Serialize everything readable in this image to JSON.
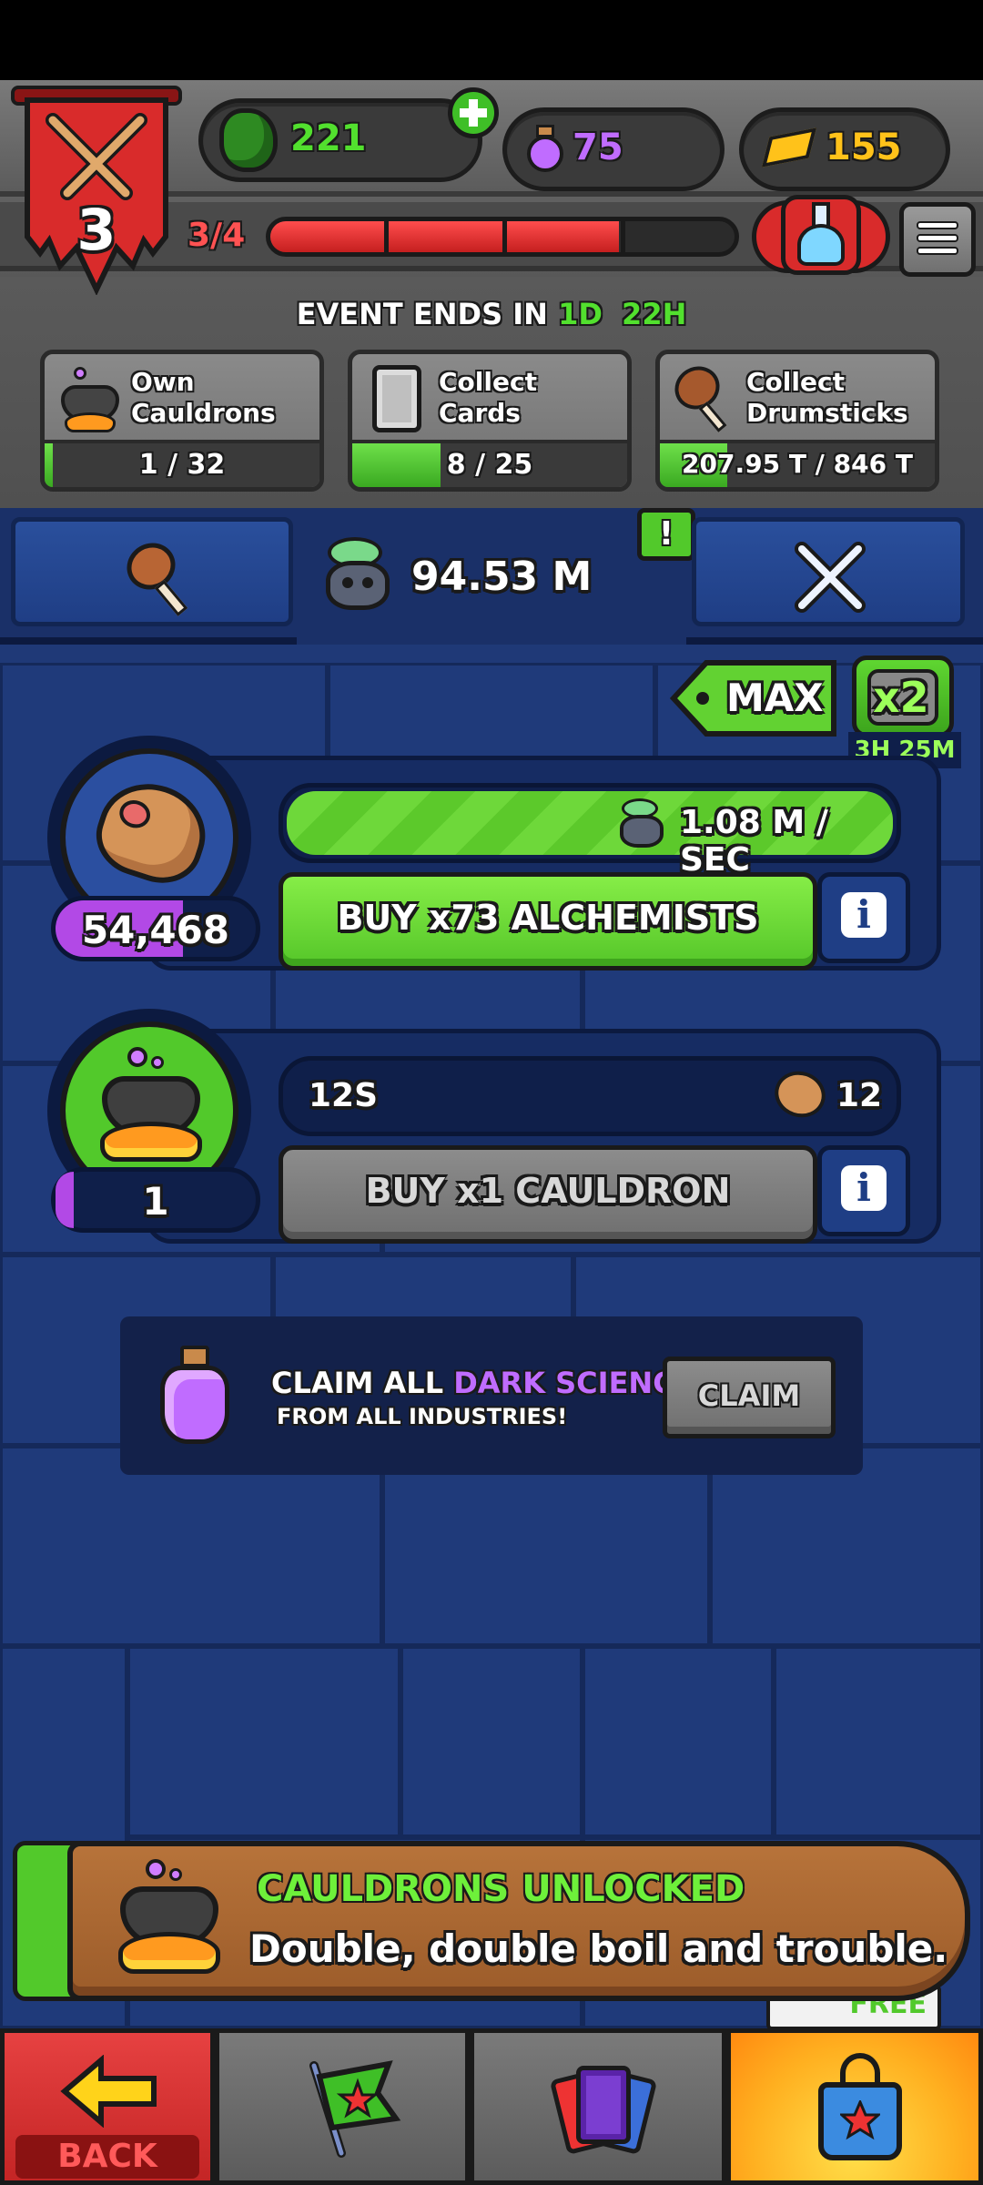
{
  "header": {
    "level": "3",
    "level_progress": "3/4",
    "level_progress_fraction": 0.75,
    "currencies": [
      {
        "name": "green-gem",
        "value": "221",
        "color": "#52e02e"
      },
      {
        "name": "dark-science-potion",
        "value": "75",
        "color": "#c06cff"
      },
      {
        "name": "gold-bars",
        "value": "155",
        "color": "#ffc21a"
      }
    ],
    "add_icon": "plus-icon",
    "event_label": "EVENT ENDS IN",
    "event_days": "1D",
    "event_hours": "22H",
    "tasks": [
      {
        "label": "Own Cauldrons",
        "line1": "Own",
        "line2": "Cauldrons",
        "progress": "1 / 32",
        "fraction": 0.03125,
        "icon": "cauldron-icon"
      },
      {
        "label": "Collect Cards",
        "line1": "Collect Cards",
        "line2": "",
        "progress": "8 / 25",
        "fraction": 0.32,
        "icon": "card-icon"
      },
      {
        "label": "Collect Drumsticks",
        "line1": "Collect",
        "line2": "Drumsticks",
        "progress": "207.95 T / 846 T",
        "fraction": 0.2458,
        "icon": "drumstick-icon"
      }
    ]
  },
  "tabs": {
    "left_icon": "drumstick-icon",
    "center_value": "94.53 M",
    "center_icon": "skull-cauldron-icon",
    "alert": "!",
    "right_icon": "crossed-swords-icon"
  },
  "boost": {
    "max_label": "MAX",
    "multiplier": "x2",
    "timer": "3H 25M"
  },
  "industry_rows": [
    {
      "icon": "hat-icon",
      "count": "54,468",
      "rate": "1.08 M / SEC",
      "rate_fraction": 1.0,
      "buy_label": "BUY x73 ALCHEMISTS",
      "info": "i"
    },
    {
      "icon": "cauldron-icon",
      "count": "1",
      "timer": "12S",
      "cost": "12",
      "buy_label": "BUY x1 CAULDRON",
      "info": "i"
    }
  ],
  "claim": {
    "line1_a": "CLAIM ALL",
    "line1_b": "DARK SCIENCE",
    "line2": "FROM ALL INDUSTRIES!",
    "button": "CLAIM",
    "accent": "#c06cff"
  },
  "notification": {
    "title": "CAULDRONS UNLOCKED",
    "body": "Double, double boil and trouble.",
    "title_color": "#6ef03a",
    "peek_text": "FREE"
  },
  "nav": {
    "back_label": "BACK",
    "items": [
      "back",
      "flag",
      "cards",
      "shop"
    ]
  }
}
